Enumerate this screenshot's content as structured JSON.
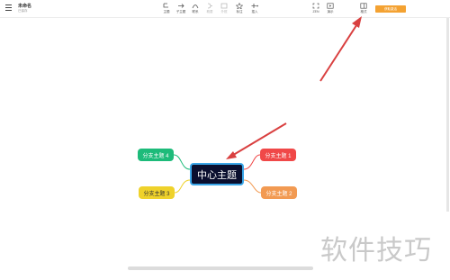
{
  "document": {
    "title": "未命名",
    "subtitle": "已保存"
  },
  "toolbar": [
    {
      "id": "topic",
      "label": "主题",
      "icon": "subtopic-icon",
      "disabled": false
    },
    {
      "id": "subtopic",
      "label": "子主题",
      "icon": "child-topic-icon",
      "disabled": false
    },
    {
      "id": "relation",
      "label": "联系",
      "icon": "relation-curve-icon",
      "disabled": false
    },
    {
      "id": "summary",
      "label": "概要",
      "icon": "summary-icon",
      "disabled": true
    },
    {
      "id": "frame",
      "label": "外框",
      "icon": "frame-icon",
      "disabled": true
    },
    {
      "id": "marker",
      "label": "标注",
      "icon": "star-icon",
      "disabled": false
    },
    {
      "id": "insert",
      "label": "插入",
      "icon": "plus-icon",
      "disabled": false
    }
  ],
  "right_tools": [
    {
      "id": "zen",
      "label": "ZEN",
      "icon": "fullscreen-icon"
    },
    {
      "id": "present",
      "label": "演示",
      "icon": "presentation-icon"
    },
    {
      "id": "format",
      "label": "格式",
      "icon": "panel-icon"
    }
  ],
  "upgrade_label": "获取激活",
  "mindmap": {
    "center": "中心主题",
    "branches": [
      "分支主题 1",
      "分支主题 2",
      "分支主题 3",
      "分支主题 4"
    ]
  },
  "colors": {
    "center_bg": "#0a0f2e",
    "center_border": "#3aa6e8",
    "branch1": "#f04848",
    "branch2": "#f29a52",
    "branch3": "#efd22b",
    "branch4": "#1dbb7a",
    "arrow": "#d94040",
    "upgrade": "#f4a232"
  },
  "watermark": "软件技巧"
}
